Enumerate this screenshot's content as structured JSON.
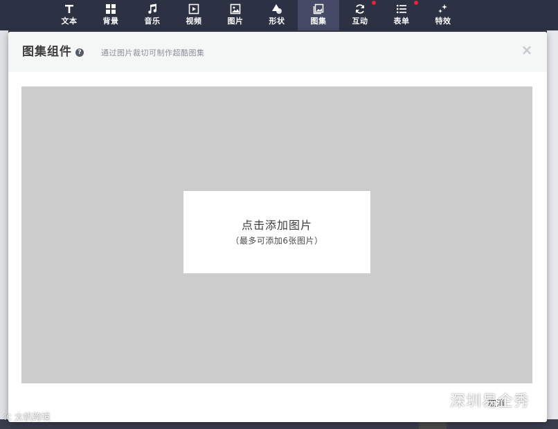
{
  "toolbar": {
    "items": [
      {
        "label": "文本",
        "icon": "text-icon"
      },
      {
        "label": "背景",
        "icon": "grid-icon"
      },
      {
        "label": "音乐",
        "icon": "music-icon"
      },
      {
        "label": "视频",
        "icon": "video-icon"
      },
      {
        "label": "图片",
        "icon": "image-icon"
      },
      {
        "label": "形状",
        "icon": "shape-icon"
      },
      {
        "label": "图集",
        "icon": "gallery-icon",
        "active": true
      },
      {
        "label": "互动",
        "icon": "refresh-icon",
        "badge": true
      },
      {
        "label": "表单",
        "icon": "list-icon",
        "badge": true
      },
      {
        "label": "特效",
        "icon": "sparkle-icon"
      }
    ]
  },
  "modal": {
    "title": "图集组件",
    "help": "?",
    "subtitle": "通过图片裁切可制作超酷图集",
    "close": "×",
    "add_title": "点击添加图片",
    "add_sub": "（最多可添加6张图片）",
    "cancel_label": "取消"
  },
  "watermark": {
    "right_text": "深圳易企秀",
    "left_logo": "iC",
    "left_text": "太帆跨境"
  },
  "colors": {
    "toolbar_bg": "#2d3144",
    "toolbar_active": "#454b66",
    "badge": "#e8223a",
    "drop_area": "#cccccc"
  }
}
